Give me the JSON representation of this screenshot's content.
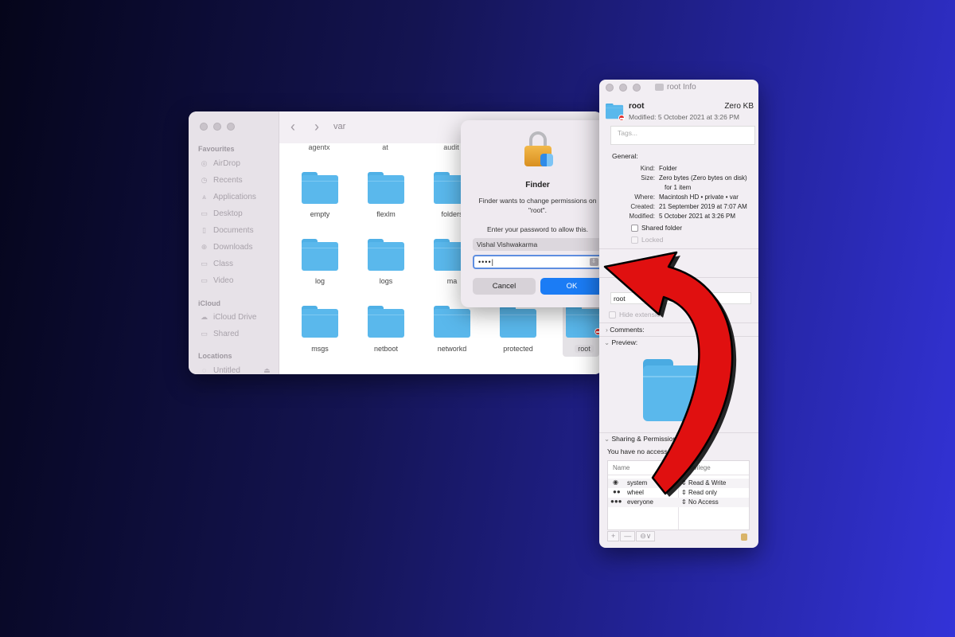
{
  "finder": {
    "title": "var",
    "sidebar": {
      "favourites_label": "Favourites",
      "favourites": [
        {
          "label": "AirDrop",
          "icon": "airdrop-icon"
        },
        {
          "label": "Recents",
          "icon": "clock-icon"
        },
        {
          "label": "Applications",
          "icon": "applications-icon"
        },
        {
          "label": "Desktop",
          "icon": "desktop-icon"
        },
        {
          "label": "Documents",
          "icon": "document-icon"
        },
        {
          "label": "Downloads",
          "icon": "download-icon"
        },
        {
          "label": "Class",
          "icon": "folder-icon"
        },
        {
          "label": "Video",
          "icon": "folder-icon"
        }
      ],
      "icloud_label": "iCloud",
      "icloud": [
        {
          "label": "iCloud Drive",
          "icon": "cloud-icon"
        },
        {
          "label": "Shared",
          "icon": "shared-folder-icon"
        }
      ],
      "locations_label": "Locations",
      "locations": [
        {
          "label": "Untitled",
          "icon": "disk-icon"
        }
      ]
    },
    "top_row": [
      "agentx",
      "at",
      "audit"
    ],
    "folders": [
      "empty",
      "flexlm",
      "folders",
      "log",
      "logs",
      "ma",
      "msgs",
      "netboot",
      "networkd",
      "protected",
      "root"
    ]
  },
  "dialog": {
    "title": "Finder",
    "message_line1": "Finder wants to change permissions on",
    "message_line2": "\"root\".",
    "prompt": "Enter your password to allow this.",
    "username": "Vishal Vishwakarma",
    "password": "••••",
    "cancel": "Cancel",
    "ok": "OK"
  },
  "info": {
    "window_title": "root Info",
    "name": "root",
    "size": "Zero KB",
    "modified_line": "Modified: 5 October 2021 at 3:26 PM",
    "tags_placeholder": "Tags...",
    "general_label": "General:",
    "general": [
      {
        "key": "Kind:",
        "value": "Folder"
      },
      {
        "key": "Size:",
        "value": "Zero bytes (Zero bytes on disk)"
      },
      {
        "key": "",
        "value": "for 1 item"
      },
      {
        "key": "Where:",
        "value": "Macintosh HD • private • var"
      },
      {
        "key": "Created:",
        "value": "21 September 2019 at 7:07 AM"
      },
      {
        "key": "Modified:",
        "value": "5 October 2021 at 3:26 PM"
      }
    ],
    "shared_folder": "Shared folder",
    "locked": "Locked",
    "name_field": "root",
    "hide_extension": "Hide extension",
    "comments_label": "Comments:",
    "preview_label": "Preview:",
    "sharing_label": "Sharing & Permissions:",
    "access_note": "You have no access",
    "table_headers": {
      "name": "Name",
      "privilege": "Privilege"
    },
    "permissions": [
      {
        "name": "system",
        "privilege": "Read & Write",
        "icon": "user-icon"
      },
      {
        "name": "wheel",
        "privilege": "Read only",
        "icon": "group-icon"
      },
      {
        "name": "everyone",
        "privilege": "No Access",
        "icon": "everyone-icon"
      }
    ],
    "tools": {
      "add": "+",
      "remove": "—",
      "action": "⊖∨"
    }
  },
  "colors": {
    "ok_button": "#1b7cf5",
    "folder": "#5ab8ec",
    "arrow": "#e01010",
    "no_entry": "#e02828"
  }
}
